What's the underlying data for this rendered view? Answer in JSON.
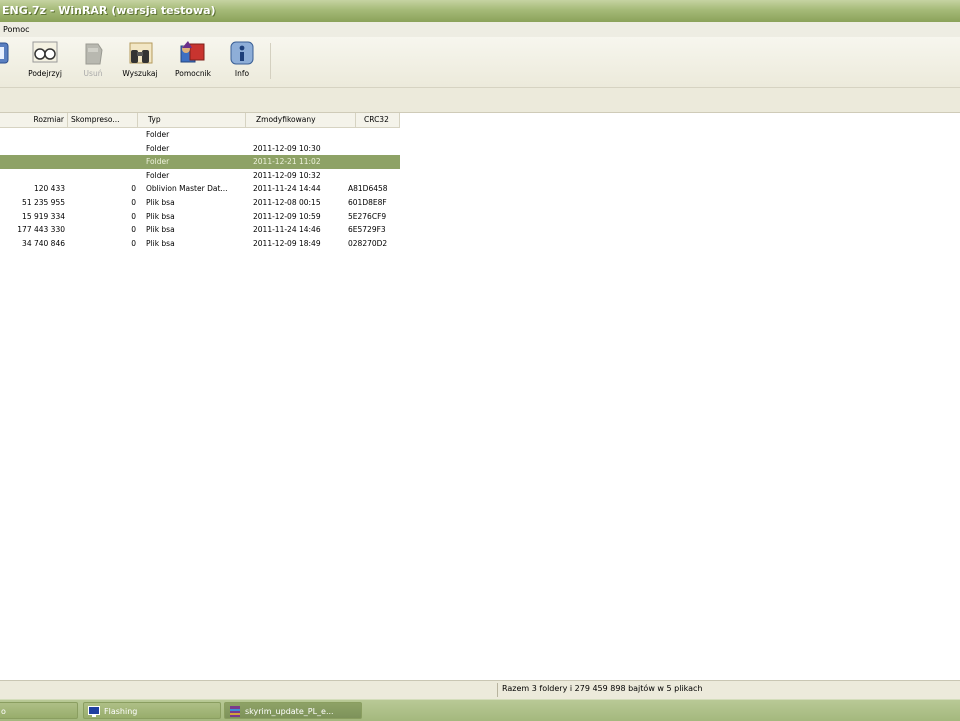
{
  "window": {
    "title": "ENG.7z - WinRAR (wersja testowa)"
  },
  "menu": {
    "items": [
      "Pomoc"
    ]
  },
  "toolbar": {
    "buttons": [
      {
        "label": "uj",
        "icon": "view-icon",
        "enabled": true
      },
      {
        "label": "Podejrzyj",
        "icon": "glasses-icon",
        "enabled": true
      },
      {
        "label": "Usuń",
        "icon": "delete-icon",
        "enabled": false
      },
      {
        "label": "Wyszukaj",
        "icon": "binoculars-icon",
        "enabled": true
      },
      {
        "label": "Pomocnik",
        "icon": "wizard-icon",
        "enabled": true
      },
      {
        "label": "Info",
        "icon": "info-icon",
        "enabled": true
      }
    ]
  },
  "columns": {
    "size": "Rozmiar",
    "packed": "Skompreso...",
    "type": "Typ",
    "modified": "Zmodyfikowany",
    "crc": "CRC32"
  },
  "files": [
    {
      "size": "",
      "packed": "",
      "type": "Folder",
      "modified": "",
      "crc": "",
      "selected": false
    },
    {
      "size": "",
      "packed": "",
      "type": "Folder",
      "modified": "2011-12-09 10:30",
      "crc": "",
      "selected": false
    },
    {
      "size": "",
      "packed": "",
      "type": "Folder",
      "modified": "2011-12-21 11:02",
      "crc": "",
      "selected": true
    },
    {
      "size": "",
      "packed": "",
      "type": "Folder",
      "modified": "2011-12-09 10:32",
      "crc": "",
      "selected": false
    },
    {
      "size": "120 433",
      "packed": "0",
      "type": "Oblivion Master Dat...",
      "modified": "2011-11-24 14:44",
      "crc": "A81D6458",
      "selected": false
    },
    {
      "size": "51 235 955",
      "packed": "0",
      "type": "Plik bsa",
      "modified": "2011-12-08 00:15",
      "crc": "601D8E8F",
      "selected": false
    },
    {
      "size": "15 919 334",
      "packed": "0",
      "type": "Plik bsa",
      "modified": "2011-12-09 10:59",
      "crc": "5E276CF9",
      "selected": false
    },
    {
      "size": "177 443 330",
      "packed": "0",
      "type": "Plik bsa",
      "modified": "2011-11-24 14:46",
      "crc": "6E5729F3",
      "selected": false
    },
    {
      "size": "34 740 846",
      "packed": "0",
      "type": "Plik bsa",
      "modified": "2011-12-09 18:49",
      "crc": "028270D2",
      "selected": false
    }
  ],
  "status": {
    "text": "Razem 3 foldery i 279 459 898 bajtów w 5 plikach"
  },
  "taskbar": {
    "items": [
      {
        "label": "o",
        "icon": "app-icon",
        "active": false
      },
      {
        "label": "Flashing",
        "icon": "monitor-icon",
        "active": false
      },
      {
        "label": "skyrim_update_PL_e...",
        "icon": "winrar-icon",
        "active": true
      }
    ]
  },
  "colors": {
    "titlebar": "#8ba25a",
    "selection": "#8ea266",
    "taskbar": "#a4b87d"
  }
}
